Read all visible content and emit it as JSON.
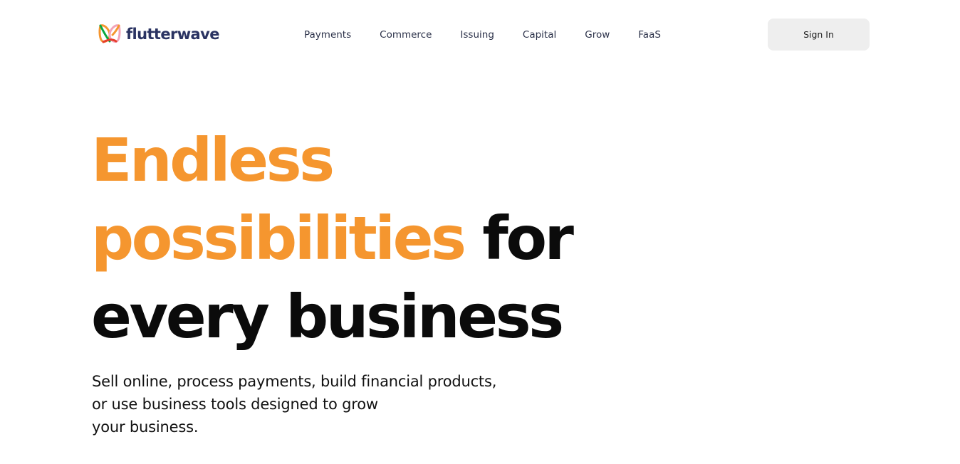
{
  "header": {
    "logo_text": "flutterwave",
    "logo_icon": "flutterwave-butterfly-logo",
    "nav": [
      "Payments",
      "Commerce",
      "Issuing",
      "Capital",
      "Grow",
      "FaaS"
    ],
    "signin_label": "Sign In"
  },
  "hero": {
    "headline": {
      "line1": "Endless",
      "line2_accent": "possibilities",
      "line2_dark": " for",
      "line3": "every business"
    },
    "subtext": {
      "line1": "Sell online, process payments, build financial products,",
      "line2": "or use business tools designed to grow",
      "line3": "your business."
    }
  },
  "colors": {
    "accent": "#f5962f",
    "dark": "#0b0b0b",
    "logo_text": "#2a3362",
    "button_bg": "#eeeeee"
  }
}
